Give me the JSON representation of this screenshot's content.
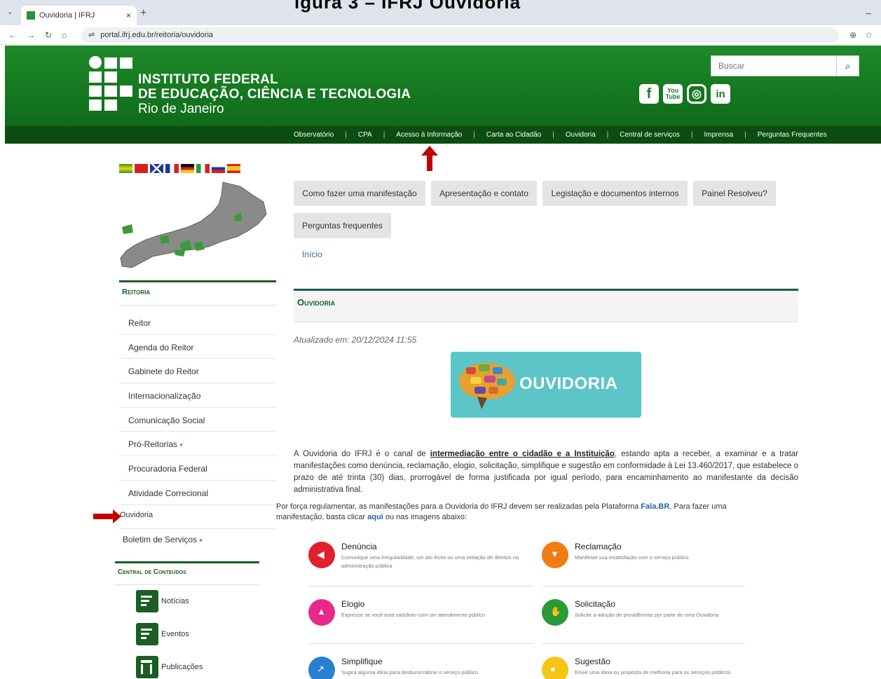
{
  "caption": "igura 3 – IFRJ Ouvidoria",
  "browser": {
    "tab_title": "Ouvidoria | IFRJ",
    "url": "portal.ifrj.edu.br/reitoria/ouvidoria"
  },
  "header": {
    "line1": "INSTITUTO FEDERAL",
    "line2": "DE EDUCAÇÃO, CIÊNCIA E TECNOLOGIA",
    "line3": "Rio de Janeiro",
    "search_placeholder": "Buscar"
  },
  "topnav": [
    "Observatório",
    "CPA",
    "Acesso à Informação",
    "Carta ao Cidadão",
    "Ouvidoria",
    "Central de serviços",
    "Imprensa",
    "Perguntas Frequentes"
  ],
  "sidebar": {
    "title": "Reitoria",
    "items": [
      "Reitor",
      "Agenda do Reitor",
      "Gabinete do Reitor",
      "Internacionalização",
      "Comunicação Social",
      "Pró-Reitorias",
      "Procuradoria Federal",
      "Atividade Correcional"
    ],
    "ouvidoria": "Ouvidoria",
    "boletim": "Boletim de Serviços"
  },
  "central": {
    "title": "Central de Conteúdos",
    "items": [
      "Notícias",
      "Eventos",
      "Publicações"
    ]
  },
  "main": {
    "pills": [
      "Como fazer uma manifestação",
      "Apresentação e contato",
      "Legislação e documentos internos",
      "Painel Resolveu?",
      "Perguntas frequentes"
    ],
    "breadcrumb": "Início",
    "title": "Ouvidoria",
    "updated": "Atualizado em: 20/12/2024 11:55",
    "banner_text": "OUVIDORIA",
    "para1_a": "A Ouvidoria do IFRJ é o canal de ",
    "para1_b": "intermediação entre o cidadão e a Instituição",
    "para1_c": ", estando apta a receber, a examinar e a tratar manifestações como denúncia, reclamação, elogio, solicitação, simplifique e sugestão em conformidade à Lei 13.460/2017, que estabelece o prazo de até trinta (30) dias, prorrogável de forma justificada por igual período, para encaminhamento ao manifestante da decisão administrativa final.",
    "para2_a": "Por força regulamentar, as manifestações para a Ouvidoria do IFRJ devem ser realizadas pela Plataforma ",
    "para2_b": "Fala.BR",
    "para2_c": ". Para fazer uma manifestação, basta clicar ",
    "para2_d": "aqui",
    "para2_e": " ou nas imagens abaixo:"
  },
  "manifestacoes": [
    {
      "title": "Denúncia",
      "desc": "Comunique uma irregularidade, um ato ilícito ou uma violação de direitos na administração pública",
      "color": "#e0202a"
    },
    {
      "title": "Reclamação",
      "desc": "Manifeste sua insatisfação com o serviço público",
      "color": "#f07d14"
    },
    {
      "title": "Elogio",
      "desc": "Expresse se você está satisfeito com um atendimento público",
      "color": "#e8288a"
    },
    {
      "title": "Solicitação",
      "desc": "Solicite a adoção de providências por parte de uma Ouvidoria",
      "color": "#2a9a38"
    },
    {
      "title": "Simplifique",
      "desc": "Sugira alguma ideia para desburocratizar o serviço público",
      "color": "#2a80d0"
    },
    {
      "title": "Sugestão",
      "desc": "Envie uma ideia ou proposta de melhoria para os serviços públicos",
      "color": "#f5c518"
    }
  ]
}
